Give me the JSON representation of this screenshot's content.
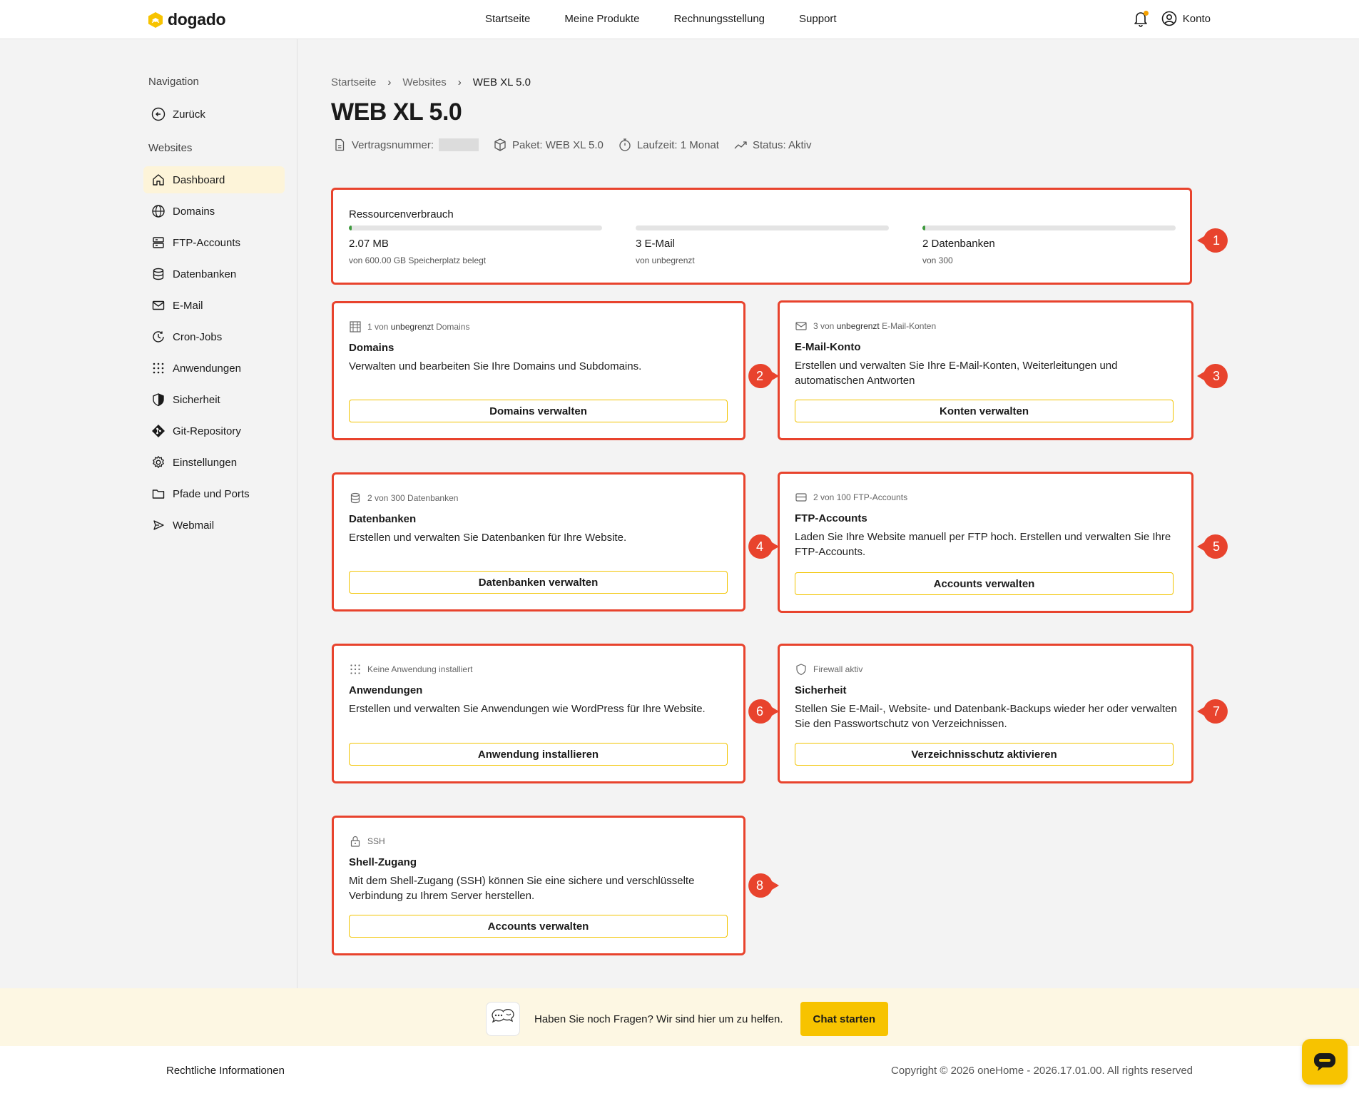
{
  "brand": {
    "name": "dogado",
    "accent": "#f7c300",
    "highlight": "#e8432d"
  },
  "topnav": [
    "Startseite",
    "Meine Produkte",
    "Rechnungsstellung",
    "Support"
  ],
  "account_label": "Konto",
  "sidebar": {
    "nav_heading": "Navigation",
    "back_label": "Zurück",
    "section_heading": "Websites",
    "items": [
      {
        "label": "Dashboard",
        "icon": "home-icon",
        "active": true
      },
      {
        "label": "Domains",
        "icon": "globe-icon"
      },
      {
        "label": "FTP-Accounts",
        "icon": "server-icon"
      },
      {
        "label": "Datenbanken",
        "icon": "database-icon"
      },
      {
        "label": "E-Mail",
        "icon": "mail-icon"
      },
      {
        "label": "Cron-Jobs",
        "icon": "clock-icon"
      },
      {
        "label": "Anwendungen",
        "icon": "grid-icon"
      },
      {
        "label": "Sicherheit",
        "icon": "shield-icon"
      },
      {
        "label": "Git-Repository",
        "icon": "git-icon"
      },
      {
        "label": "Einstellungen",
        "icon": "gear-icon"
      },
      {
        "label": "Pfade und Ports",
        "icon": "folder-icon"
      },
      {
        "label": "Webmail",
        "icon": "send-icon"
      }
    ]
  },
  "breadcrumb": [
    "Startseite",
    "Websites",
    "WEB XL 5.0"
  ],
  "page_title": "WEB XL 5.0",
  "meta": {
    "contract_label": "Vertragsnummer:",
    "package": "Paket: WEB XL 5.0",
    "duration": "Laufzeit: 1 Monat",
    "status": "Status: Aktiv"
  },
  "resources": {
    "title": "Ressourcenverbrauch",
    "items": [
      {
        "value": "2.07 MB",
        "sub": "von 600.00 GB Speicherplatz belegt",
        "fill": 0.01
      },
      {
        "value": "3 E-Mail",
        "sub": "von unbegrenzt",
        "fill": 0
      },
      {
        "value": "2 Datenbanken",
        "sub": "von 300",
        "fill": 0.01
      }
    ]
  },
  "cards": [
    {
      "tag_prefix": "1 von",
      "tag_bold": "unbegrenzt",
      "tag_suffix": "Domains",
      "title": "Domains",
      "desc": "Verwalten und bearbeiten Sie Ihre Domains und Subdomains.",
      "button": "Domains verwalten",
      "icon": "building-icon"
    },
    {
      "tag_prefix": "3 von",
      "tag_bold": "unbegrenzt",
      "tag_suffix": "E-Mail-Konten",
      "title": "E-Mail-Konto",
      "desc": "Erstellen und verwalten Sie Ihre E-Mail-Konten, Weiterleitungen und automatischen Antworten",
      "button": "Konten verwalten",
      "icon": "mail-icon"
    },
    {
      "tag_prefix": "2 von 300 Datenbanken",
      "tag_bold": "",
      "tag_suffix": "",
      "title": "Datenbanken",
      "desc": "Erstellen und verwalten Sie Datenbanken für Ihre Website.",
      "button": "Datenbanken verwalten",
      "icon": "database-icon"
    },
    {
      "tag_prefix": "2 von 100 FTP-Accounts",
      "tag_bold": "",
      "tag_suffix": "",
      "title": "FTP-Accounts",
      "desc": "Laden Sie Ihre Website manuell per FTP hoch. Erstellen und verwalten Sie Ihre FTP-Accounts.",
      "button": "Accounts verwalten",
      "icon": "drive-icon"
    },
    {
      "tag_prefix": "Keine Anwendung installiert",
      "tag_bold": "",
      "tag_suffix": "",
      "title": "Anwendungen",
      "desc": "Erstellen und verwalten Sie Anwendungen wie WordPress für Ihre Website.",
      "button": "Anwendung installieren",
      "icon": "grid-icon"
    },
    {
      "tag_prefix": "Firewall aktiv",
      "tag_bold": "",
      "tag_suffix": "",
      "title": "Sicherheit",
      "desc": "Stellen Sie E-Mail-, Website- und Datenbank-Backups wieder her oder verwalten Sie den Passwortschutz von Verzeichnissen.",
      "button": "Verzeichnisschutz aktivieren",
      "icon": "shield-icon"
    },
    {
      "tag_prefix": "SSH",
      "tag_bold": "",
      "tag_suffix": "",
      "title": "Shell-Zugang",
      "desc": "Mit dem Shell-Zugang (SSH) können Sie eine sichere und verschlüsselte Verbindung zu Ihrem Server herstellen.",
      "button": "Accounts verwalten",
      "icon": "lock-icon"
    }
  ],
  "badges": [
    "1",
    "2",
    "3",
    "4",
    "5",
    "6",
    "7",
    "8"
  ],
  "help": {
    "text": "Haben Sie noch Fragen? Wir sind hier um zu helfen.",
    "button": "Chat starten"
  },
  "footer": {
    "left": "Rechtliche Informationen",
    "right": "Copyright © 2026 oneHome - 2026.17.01.00. All rights reserved"
  }
}
